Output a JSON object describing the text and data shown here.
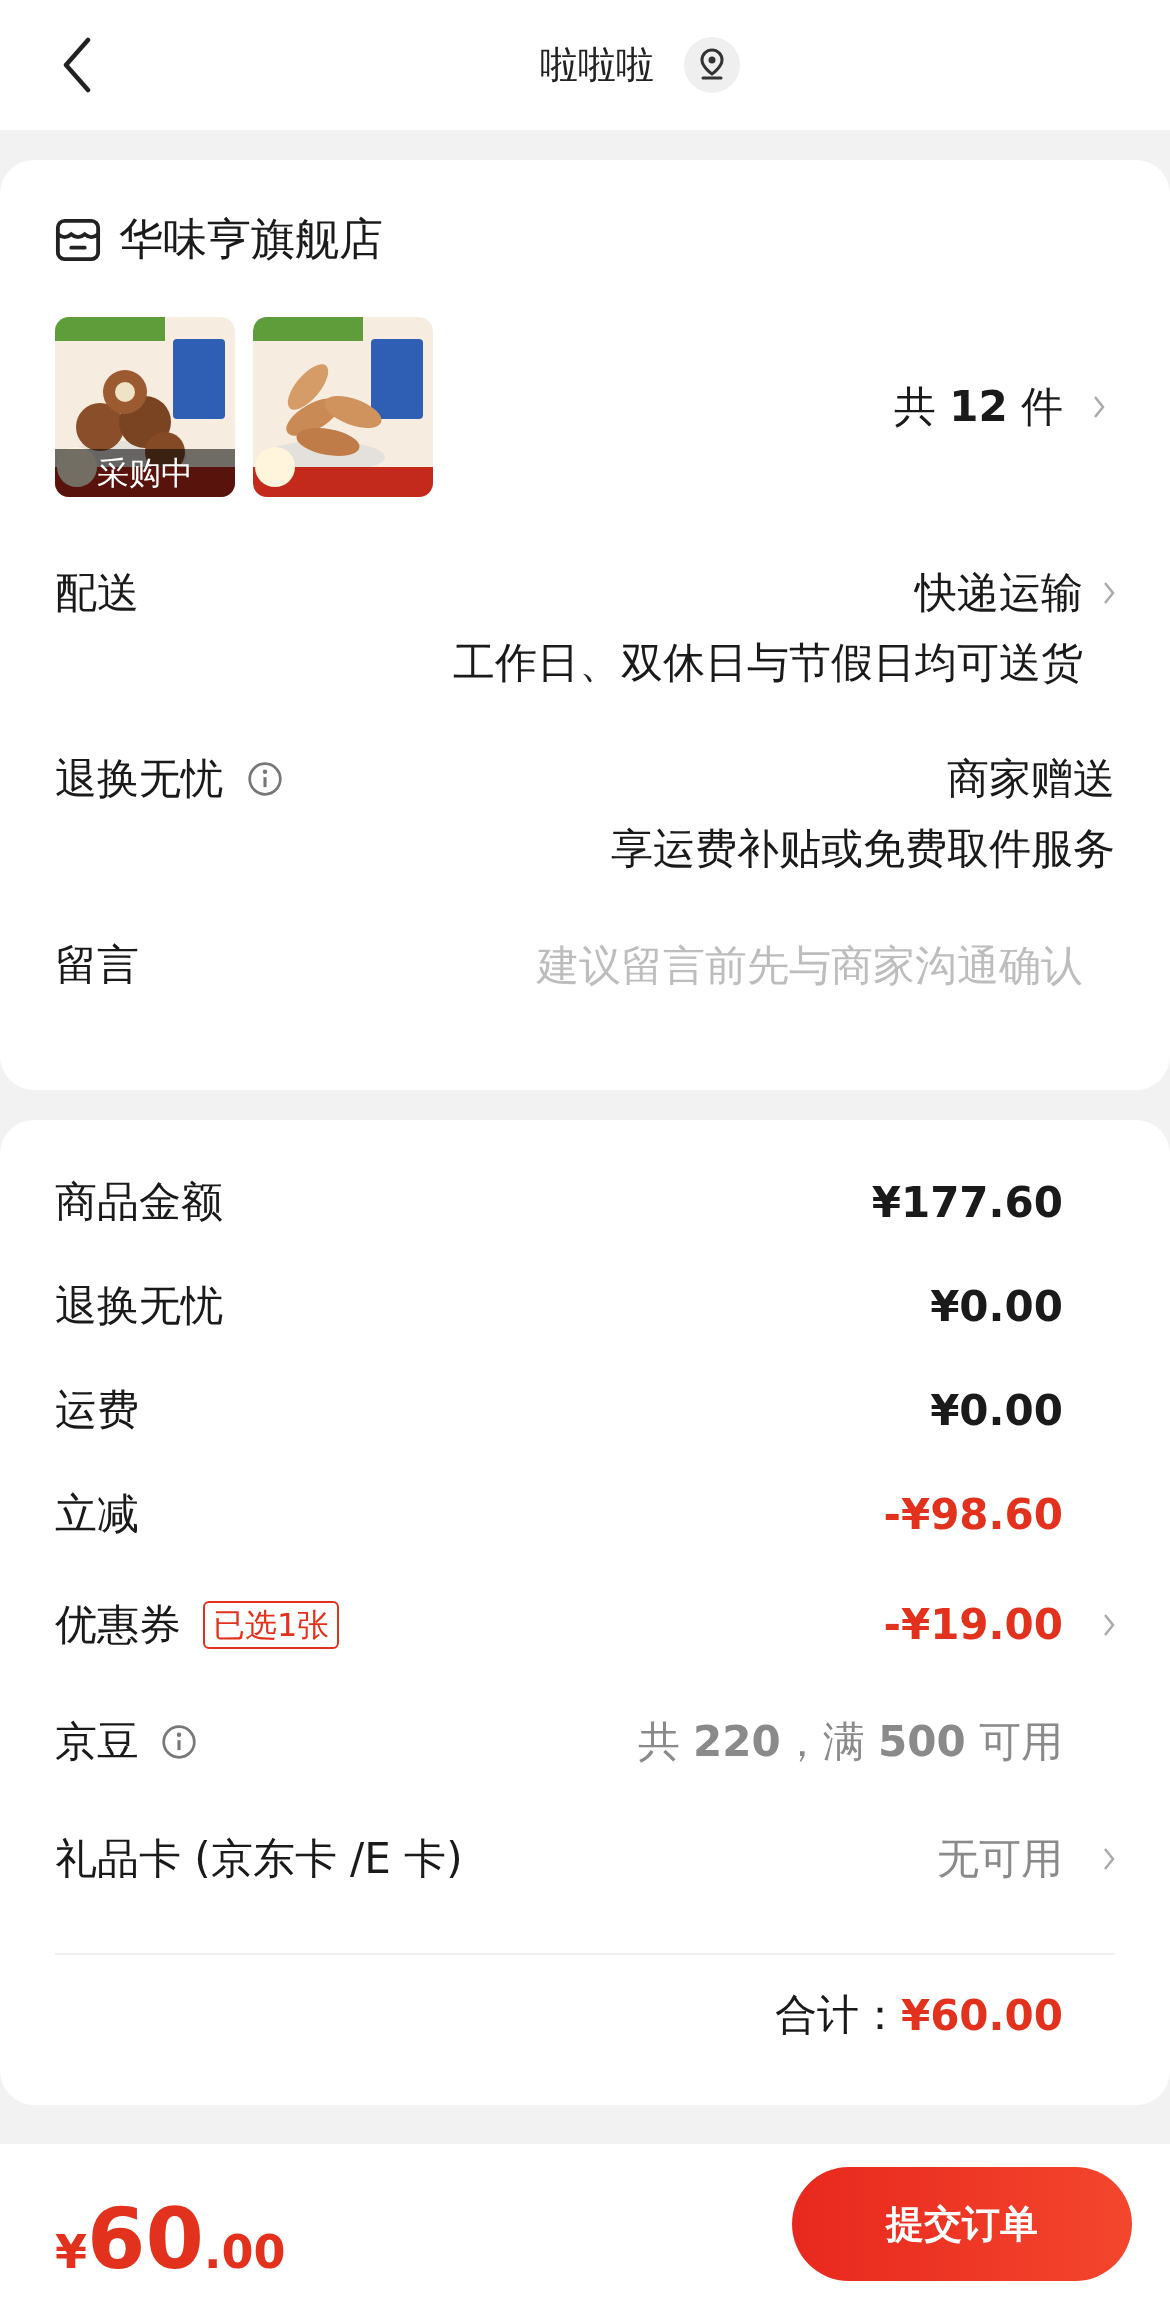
{
  "header": {
    "title": "啦啦啦"
  },
  "shop": {
    "name": "华味亨旗舰店",
    "products": [
      {
        "kind": "picture",
        "overlay": "采购中"
      },
      {
        "kind": "picture"
      }
    ],
    "count": "共 **12** 件"
  },
  "options": [
    {
      "kind": "value",
      "label": "配送",
      "info": false,
      "value": "快递运输",
      "note": "工作日、双休日与节假日均可送货",
      "chevron": true
    },
    {
      "kind": "value",
      "label": "退换无忧",
      "info": true,
      "value": "商家赠送",
      "note": "享运费补贴或免费取件服务",
      "chevron": false
    },
    {
      "kind": "input",
      "label": "留言",
      "placeholder": "建议留言前先与商家沟通确认"
    }
  ],
  "summary": [
    {
      "label": "商品金额",
      "value": "¥177.60",
      "kind": "amount",
      "info": false,
      "chevron": false
    },
    {
      "label": "退换无忧",
      "value": "¥0.00",
      "kind": "amount",
      "info": false,
      "chevron": false
    },
    {
      "label": "运费",
      "value": "¥0.00",
      "kind": "amount",
      "info": false,
      "chevron": false
    },
    {
      "label": "立减",
      "value": "-¥98.60",
      "kind": "discount",
      "info": false,
      "chevron": false
    },
    {
      "label": "优惠券",
      "badge": "已选1张",
      "value": "-¥19.00",
      "kind": "discount",
      "info": false,
      "chevron": true
    },
    {
      "label": "京豆",
      "value": "共 **220**，满 **500** 可用",
      "kind": "hint",
      "info": true,
      "chevron": false
    },
    {
      "label": "礼品卡 (京东卡 /E 卡)",
      "value": "无可用",
      "kind": "hint",
      "info": false,
      "chevron": true
    }
  ],
  "total": {
    "label": "合计：",
    "value": "¥60.00"
  },
  "footer": {
    "currency": "¥",
    "integer": "60",
    "decimal": ".00",
    "button": "提交订单"
  }
}
